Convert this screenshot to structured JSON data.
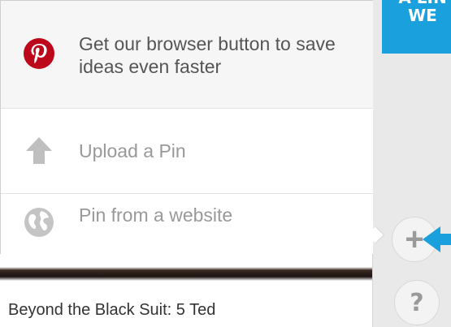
{
  "callout": {
    "line1": "A LIN",
    "line2": "WE"
  },
  "menu": {
    "items": [
      {
        "label": "Get our browser button to save ideas even faster",
        "icon": "pinterest-logo-icon",
        "color": "#bd081c"
      },
      {
        "label": "Upload a Pin",
        "icon": "upload-arrow-icon"
      },
      {
        "label": "Pin from a website",
        "icon": "globe-icon"
      }
    ]
  },
  "feed": {
    "caption": "Beyond the Black Suit: 5 Ted"
  },
  "buttons": {
    "add": "+",
    "help": "?"
  },
  "colors": {
    "accent": "#1aa0dc",
    "brand": "#bd081c"
  }
}
